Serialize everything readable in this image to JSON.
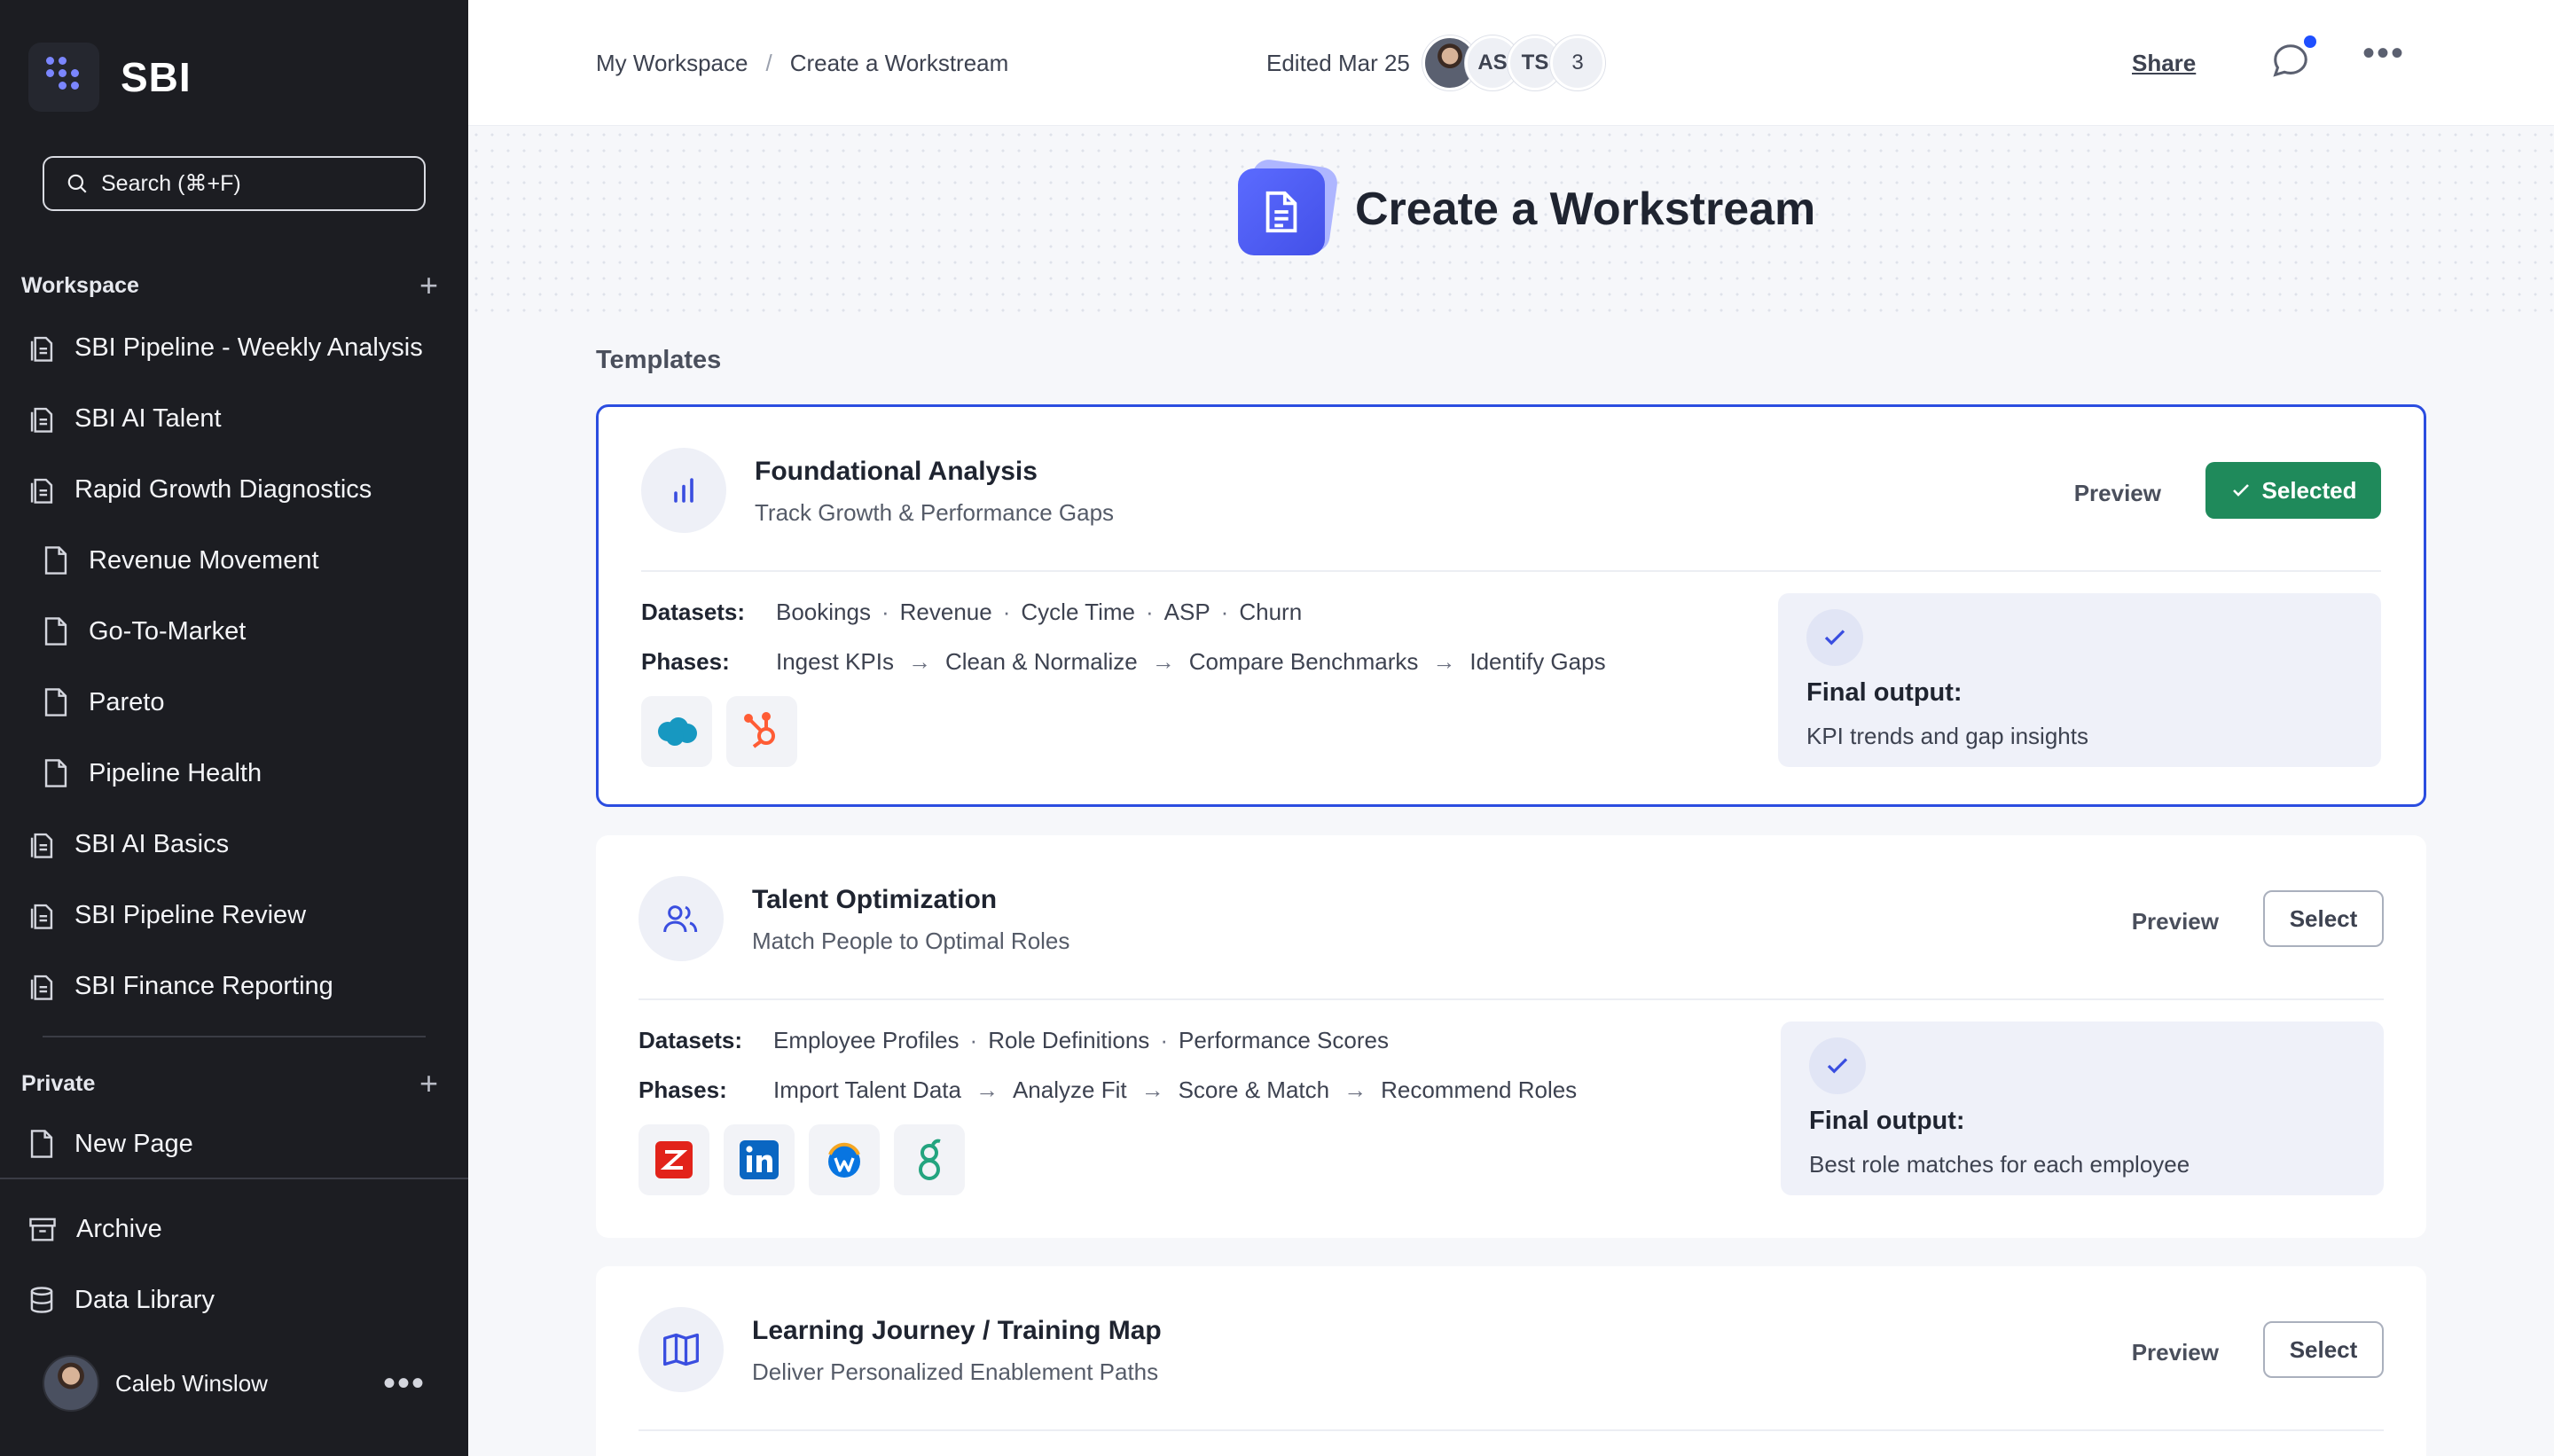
{
  "brand": {
    "name": "SBI"
  },
  "search": {
    "placeholder": "Search (⌘+F)"
  },
  "sidebar": {
    "workspace_label": "Workspace",
    "workspace_items": [
      {
        "label": "SBI Pipeline - Weekly Analysis",
        "icon": "stack-doc-icon"
      },
      {
        "label": "SBI AI Talent",
        "icon": "stack-doc-icon"
      },
      {
        "label": "Rapid Growth Diagnostics",
        "icon": "stack-doc-icon"
      },
      {
        "label": "Revenue Movement",
        "icon": "doc-icon"
      },
      {
        "label": "Go-To-Market",
        "icon": "doc-icon"
      },
      {
        "label": "Pareto",
        "icon": "doc-icon"
      },
      {
        "label": "Pipeline Health",
        "icon": "doc-icon"
      },
      {
        "label": "SBI AI Basics",
        "icon": "stack-doc-icon"
      },
      {
        "label": "SBI Pipeline Review",
        "icon": "stack-doc-icon"
      },
      {
        "label": "SBI Finance Reporting",
        "icon": "stack-doc-icon"
      }
    ],
    "private_label": "Private",
    "private_items": [
      {
        "label": "New Page",
        "icon": "doc-icon"
      }
    ],
    "footer_items": [
      {
        "label": "Archive",
        "icon": "archive-icon"
      },
      {
        "label": "Data Library",
        "icon": "database-icon"
      }
    ],
    "user": {
      "name": "Caleb Winslow"
    }
  },
  "topbar": {
    "breadcrumb": [
      "My Workspace",
      "Create a Workstream"
    ],
    "breadcrumb_sep": "/",
    "edited": "Edited Mar 25",
    "collaborators": [
      "AS",
      "TS"
    ],
    "extra_count": "3",
    "share_label": "Share"
  },
  "page": {
    "title": "Create a Workstream",
    "templates_label": "Templates"
  },
  "labels": {
    "preview": "Preview",
    "selected": "Selected",
    "select": "Select",
    "datasets": "Datasets:",
    "phases": "Phases:",
    "final_output": "Final output:"
  },
  "templates": [
    {
      "title": "Foundational Analysis",
      "subtitle": "Track Growth & Performance Gaps",
      "datasets": [
        "Bookings",
        "Revenue",
        "Cycle Time",
        "ASP",
        "Churn"
      ],
      "phases": [
        "Ingest KPIs",
        "Clean & Normalize",
        "Compare Benchmarks",
        "Identify Gaps"
      ],
      "final_output": "KPI trends and gap insights",
      "logos": [
        "salesforce-logo",
        "hubspot-logo"
      ],
      "selected": true
    },
    {
      "title": "Talent Optimization",
      "subtitle": "Match People to Optimal Roles",
      "datasets": [
        "Employee Profiles",
        "Role Definitions",
        "Performance Scores"
      ],
      "phases": [
        "Import Talent Data",
        "Analyze Fit",
        "Score & Match",
        "Recommend Roles"
      ],
      "final_output": "Best role matches for each employee",
      "logos": [
        "zoominfo-logo",
        "linkedin-logo",
        "workday-logo",
        "greenhouse-logo"
      ],
      "selected": false
    },
    {
      "title": "Learning Journey / Training Map",
      "subtitle": "Deliver Personalized Enablement Paths",
      "selected": false
    }
  ],
  "colors": {
    "accent": "#2b4de0",
    "selected_green": "#1f8a5b",
    "sidebar_bg": "#1c1d22"
  }
}
